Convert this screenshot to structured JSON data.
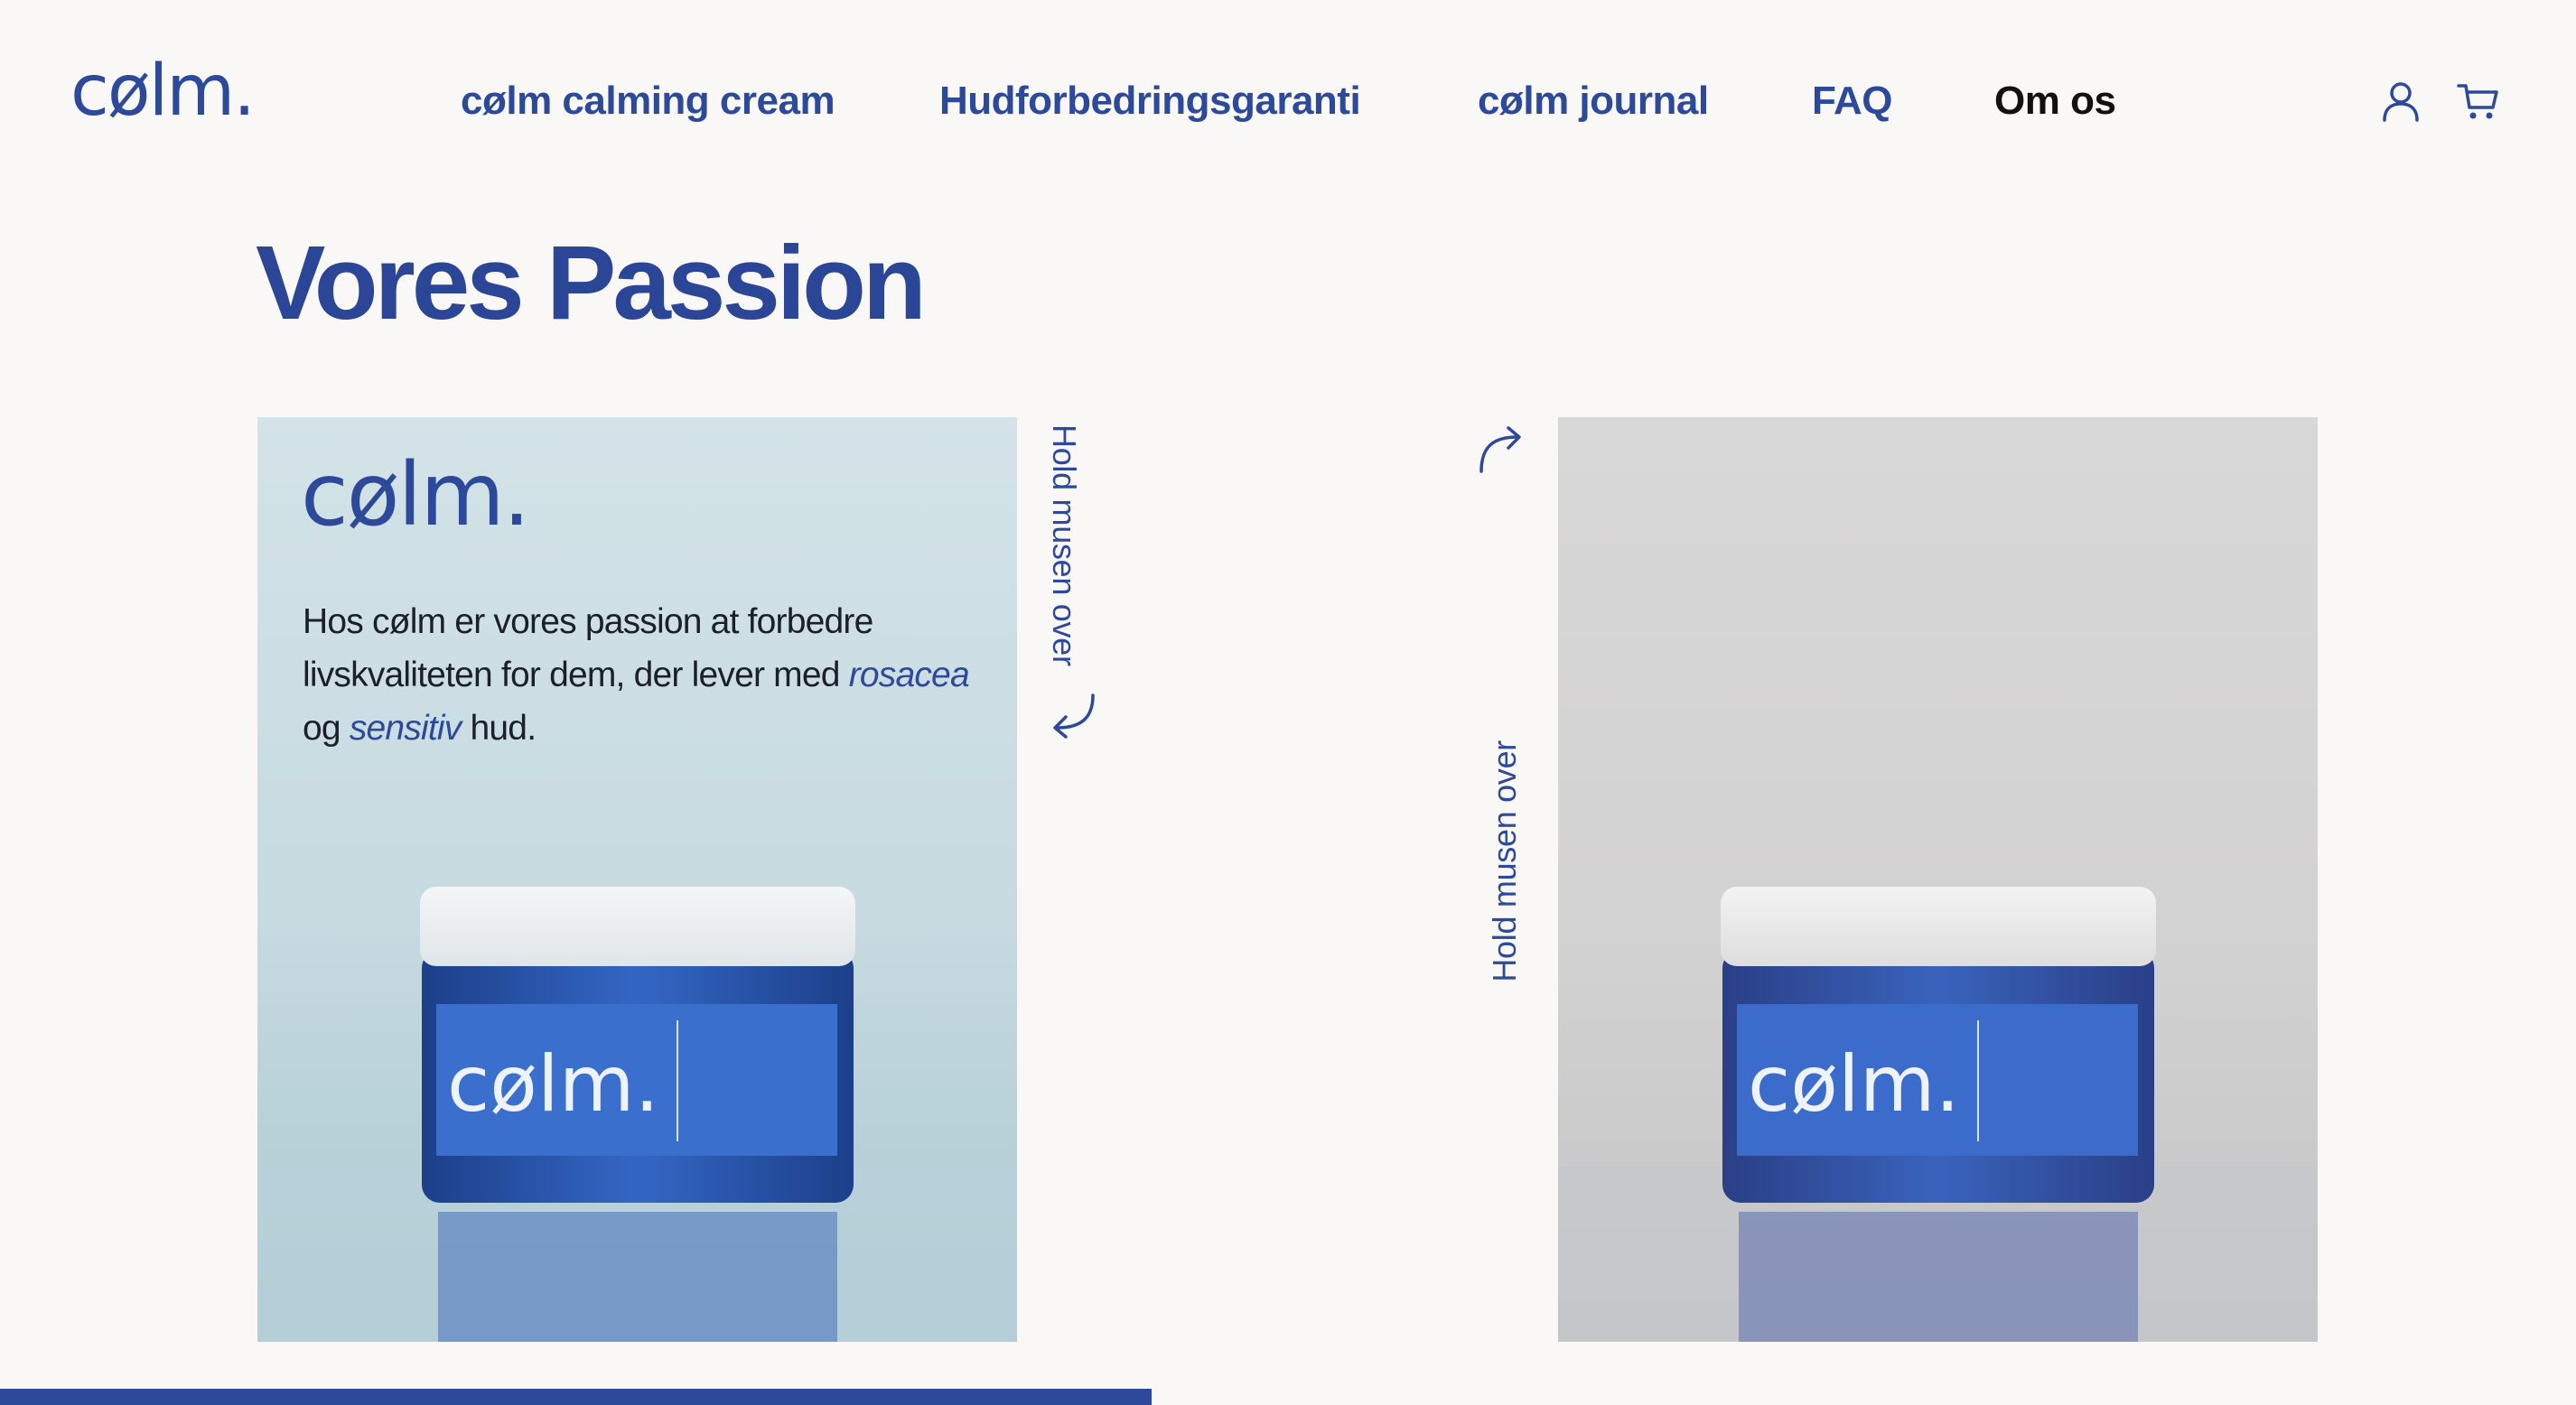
{
  "brand": {
    "logo": "cølm."
  },
  "nav": {
    "items": [
      {
        "label": "cølm calming cream"
      },
      {
        "label": "Hudforbedringsgaranti"
      },
      {
        "label": "cølm journal"
      },
      {
        "label": "FAQ"
      },
      {
        "label": "Om os",
        "active": true
      }
    ],
    "icons": [
      "user-icon",
      "cart-icon"
    ]
  },
  "page": {
    "title": "Vores Passion"
  },
  "card_left": {
    "logo": "cølm.",
    "text_before": "Hos cølm er vores passion at forbedre livskvaliteten for dem, der lever med ",
    "highlight_1": "rosacea",
    "text_middle": " og ",
    "highlight_2": "sensitiv",
    "text_after": " hud.",
    "jar_label": "cølm."
  },
  "card_right": {
    "jar_label": "cølm."
  },
  "hints": {
    "right": "Hold musen over",
    "left": "Hold musen over"
  },
  "colors": {
    "brand": "#2d4a9a",
    "background": "#f9f8f7",
    "active_nav": "#111111"
  },
  "progress": {
    "fraction": 0.447
  }
}
